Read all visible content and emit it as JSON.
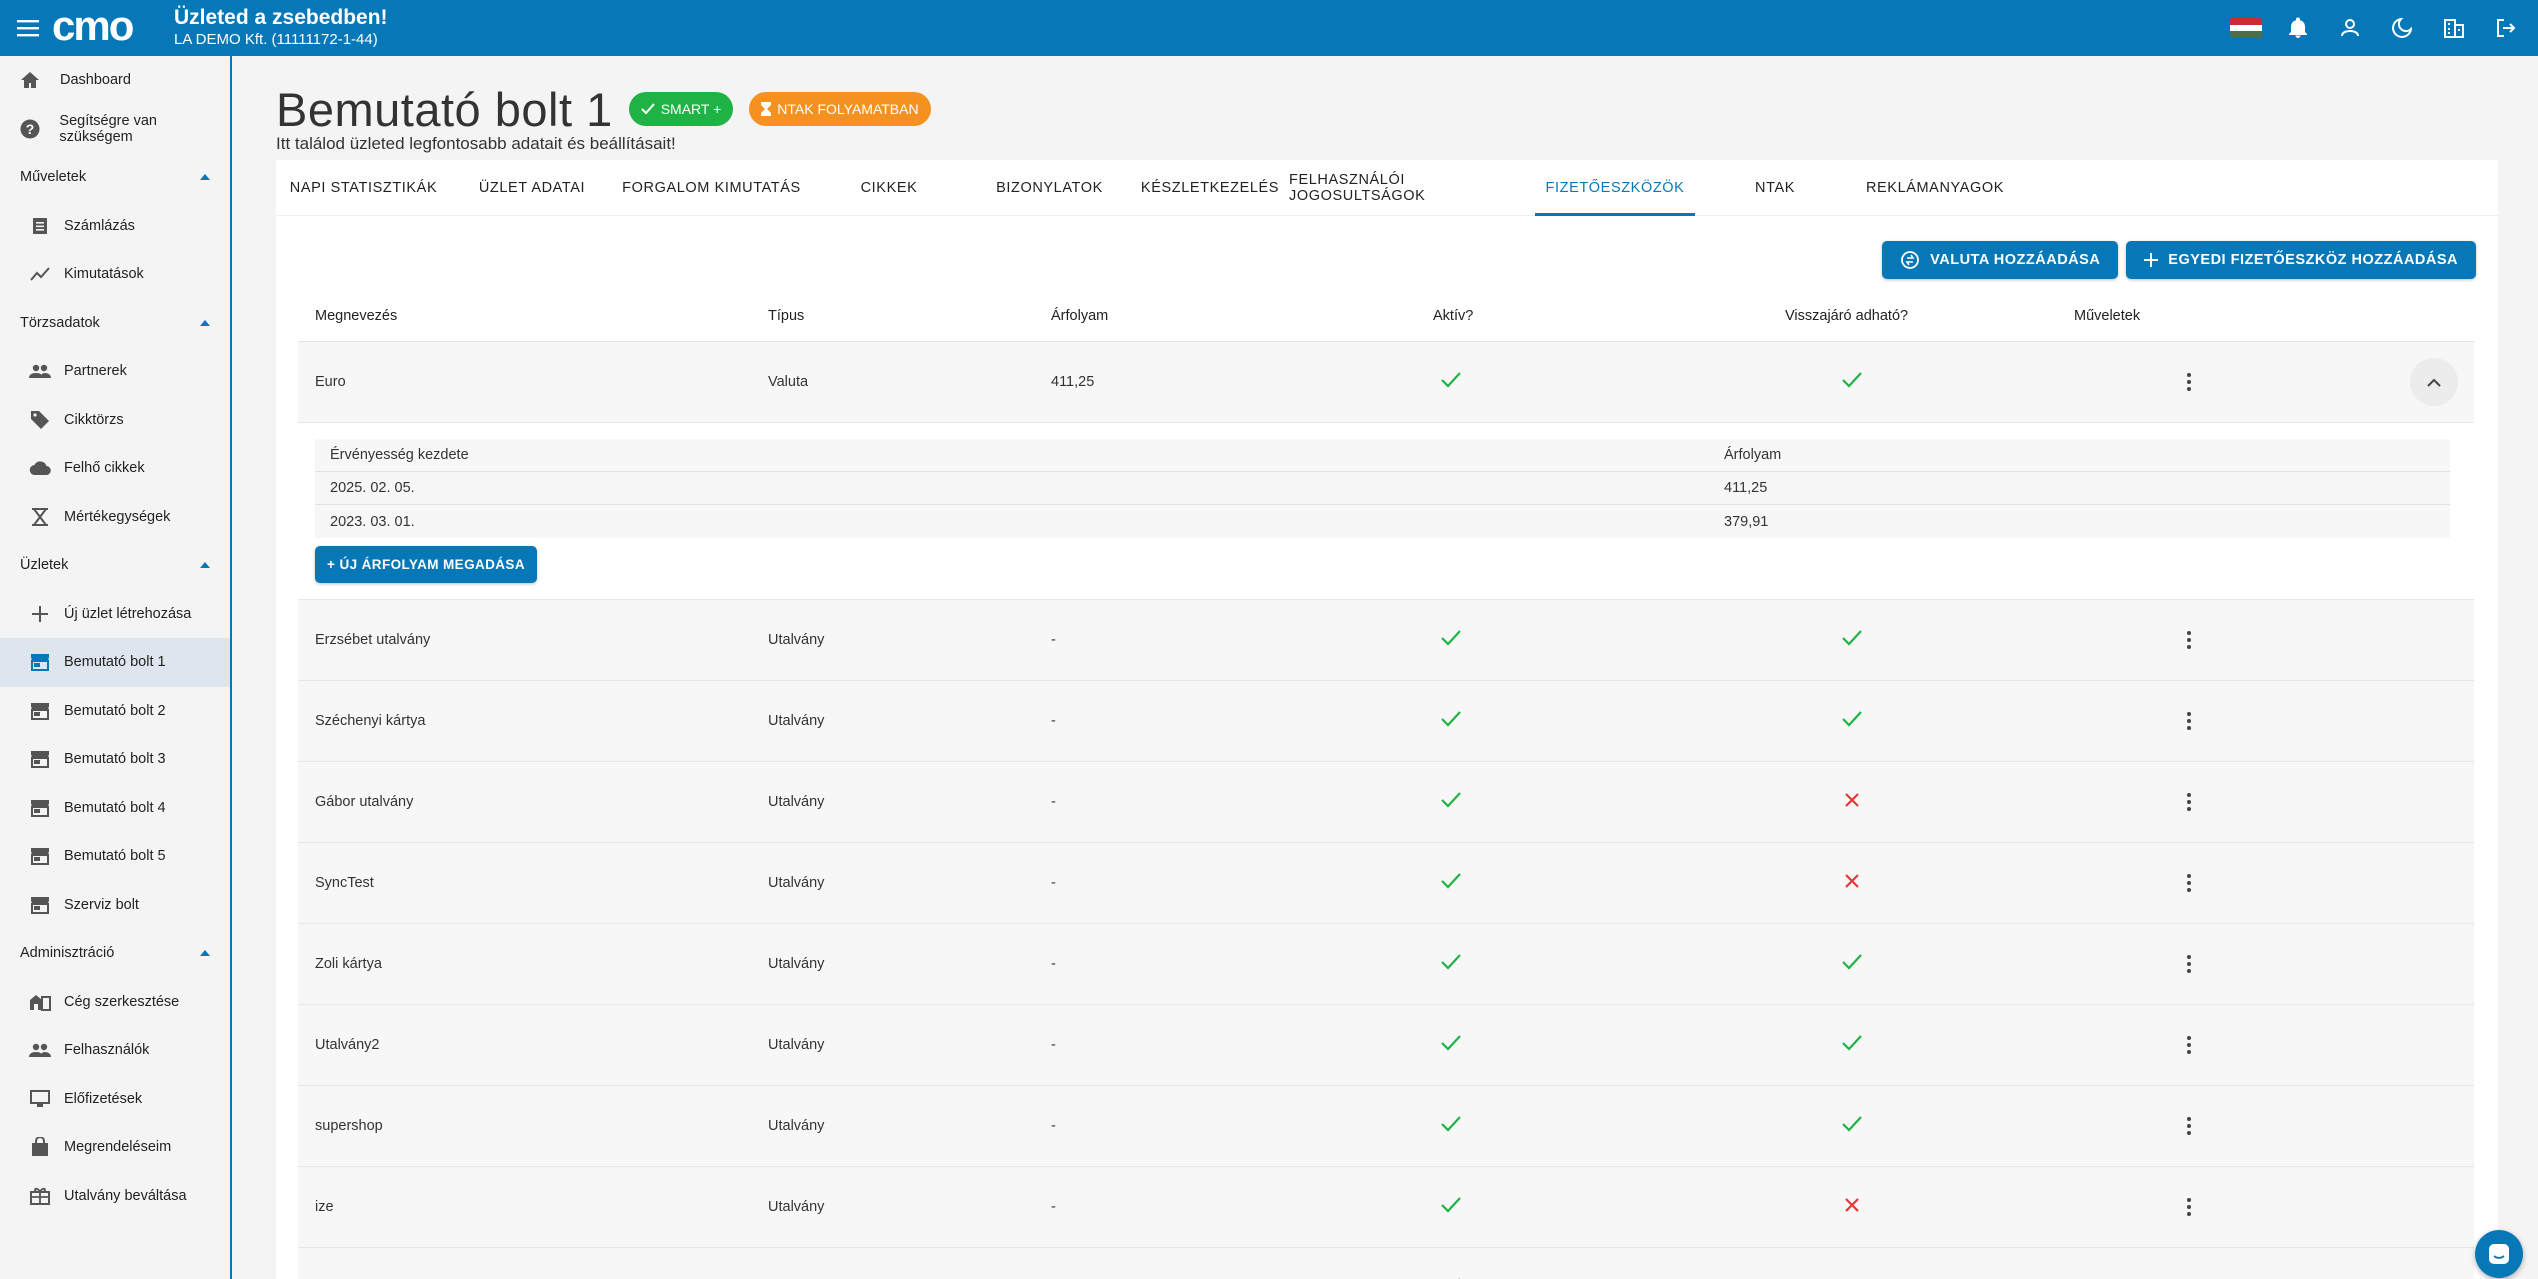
{
  "header": {
    "logo_text": "cmo",
    "title": "Üzleted a zsebedben!",
    "company": "LA DEMO Kft. (11111172-1-44)",
    "flag_colors": [
      "#ce2939",
      "#ffffff",
      "#477050"
    ],
    "icons": [
      "flag-icon",
      "bell-icon",
      "person-icon",
      "moon-icon",
      "building-icon",
      "logout-icon"
    ]
  },
  "sidebar": {
    "top_items": [
      {
        "label": "Dashboard",
        "icon": "home-icon"
      },
      {
        "label": "Segítségre van szükségem",
        "icon": "help-icon"
      }
    ],
    "sections": [
      {
        "title": "Műveletek",
        "items": [
          {
            "label": "Számlázás",
            "icon": "receipt-icon"
          },
          {
            "label": "Kimutatások",
            "icon": "chart-icon"
          }
        ]
      },
      {
        "title": "Törzsadatok",
        "items": [
          {
            "label": "Partnerek",
            "icon": "people-icon"
          },
          {
            "label": "Cikktörzs",
            "icon": "tag-icon"
          },
          {
            "label": "Felhő cikkek",
            "icon": "cloud-icon"
          },
          {
            "label": "Mértékegységek",
            "icon": "scale-icon"
          }
        ]
      },
      {
        "title": "Üzletek",
        "items": [
          {
            "label": "Új üzlet létrehozása",
            "icon": "plus-icon"
          },
          {
            "label": "Bemutató bolt 1",
            "icon": "store-icon",
            "active": true
          },
          {
            "label": "Bemutató bolt 2",
            "icon": "store-icon"
          },
          {
            "label": "Bemutató bolt 3",
            "icon": "store-icon"
          },
          {
            "label": "Bemutató bolt 4",
            "icon": "store-icon"
          },
          {
            "label": "Bemutató bolt 5",
            "icon": "store-icon"
          },
          {
            "label": "Szerviz bolt",
            "icon": "store-icon"
          }
        ]
      },
      {
        "title": "Adminisztráció",
        "items": [
          {
            "label": "Cég szerkesztése",
            "icon": "company-icon"
          },
          {
            "label": "Felhasználók",
            "icon": "people-icon"
          },
          {
            "label": "Előfizetések",
            "icon": "monitor-icon"
          },
          {
            "label": "Megrendeléseim",
            "icon": "bag-icon"
          },
          {
            "label": "Utalvány beváltása",
            "icon": "gift-icon"
          }
        ]
      }
    ]
  },
  "page": {
    "title": "Bemutató bolt 1",
    "chip_smart": "SMART +",
    "chip_ntak": "NTAK FOLYAMATBAN",
    "subtitle": "Itt találod üzleted legfontosabb adatait és beállításait!"
  },
  "tabs": [
    {
      "label": "NAPI STATISZTIKÁK"
    },
    {
      "label": "ÜZLET ADATAI"
    },
    {
      "label": "FORGALOM KIMUTATÁS"
    },
    {
      "label": "CIKKEK"
    },
    {
      "label": "BIZONYLATOK"
    },
    {
      "label": "KÉSZLETKEZELÉS"
    },
    {
      "label": "FELHASZNÁLÓI JOGOSULTSÁGOK"
    },
    {
      "label": "FIZETŐESZKÖZÖK",
      "active": true
    },
    {
      "label": "NTAK"
    },
    {
      "label": "REKLÁMANYAGOK"
    }
  ],
  "actions": {
    "add_currency": "VALUTA HOZZÁADÁSA",
    "add_custom": "EGYEDI FIZETŐESZKÖZ HOZZÁADÁSA"
  },
  "table": {
    "headers": [
      "Megnevezés",
      "Típus",
      "Árfolyam",
      "Aktív?",
      "Visszajáró adható?",
      "Műveletek"
    ],
    "expanded": {
      "name": "Euro",
      "type": "Valuta",
      "rate": "411,25",
      "active": true,
      "change": true,
      "history_headers": [
        "Érvényesség kezdete",
        "Árfolyam"
      ],
      "history": [
        {
          "date": "2025. 02. 05.",
          "rate": "411,25"
        },
        {
          "date": "2023. 03. 01.",
          "rate": "379,91"
        }
      ],
      "new_rate_button": "+ ÚJ ÁRFOLYAM MEGADÁSA"
    },
    "rows": [
      {
        "name": "Erzsébet utalvány",
        "type": "Utalvány",
        "rate": "-",
        "active": true,
        "change": true
      },
      {
        "name": "Széchenyi kártya",
        "type": "Utalvány",
        "rate": "-",
        "active": true,
        "change": true
      },
      {
        "name": "Gábor utalvány",
        "type": "Utalvány",
        "rate": "-",
        "active": true,
        "change": false
      },
      {
        "name": "SyncTest",
        "type": "Utalvány",
        "rate": "-",
        "active": true,
        "change": false
      },
      {
        "name": "Zoli kártya",
        "type": "Utalvány",
        "rate": "-",
        "active": true,
        "change": true
      },
      {
        "name": "Utalvány2",
        "type": "Utalvány",
        "rate": "-",
        "active": true,
        "change": true
      },
      {
        "name": "supershop",
        "type": "Utalvány",
        "rate": "-",
        "active": true,
        "change": true
      },
      {
        "name": "ize",
        "type": "Utalvány",
        "rate": "-",
        "active": true,
        "change": false
      },
      {
        "name": "",
        "type": "",
        "rate": "",
        "active": true,
        "change": false
      }
    ]
  },
  "colors": {
    "primary": "#0678b8",
    "check": "#1fb346",
    "cross": "#e53935",
    "smart_chip": "#1fb346",
    "ntak_chip": "#f5911e"
  }
}
